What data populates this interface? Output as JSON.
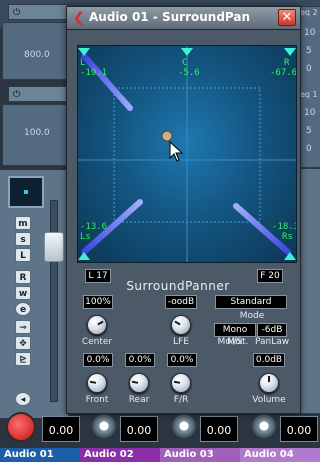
{
  "mixer": {
    "top_num_1": "800.0",
    "top_num_2": "100.0",
    "right_label_1": "eq 2",
    "right_label_2": "eq 1",
    "right_nums": [
      "10",
      "5",
      "0",
      "10",
      "5",
      "0",
      "5",
      "7.0"
    ],
    "side_buttons": [
      "m",
      "s",
      "L",
      "R",
      "w",
      "e"
    ],
    "channels": [
      {
        "name": "Audio 01",
        "value": "0.00",
        "unit": "-∞"
      },
      {
        "name": "Audio 02",
        "value": "0.00",
        "unit": "-∞"
      },
      {
        "name": "Audio 03",
        "value": "0.00",
        "unit": "-∞"
      },
      {
        "name": "Audio 04",
        "value": "0.00",
        "unit": "-∞"
      }
    ]
  },
  "window": {
    "title": "Audio 01 - SurroundPan",
    "close_label": "✕"
  },
  "speakers": {
    "L": {
      "label": "L",
      "value": "-19.1"
    },
    "C": {
      "label": "C",
      "value": "-5.6"
    },
    "R": {
      "label": "R",
      "value": "-67.6"
    },
    "Ls": {
      "label": "Ls",
      "value": "-13.6"
    },
    "Rs": {
      "label": "Rs",
      "value": "-18.3"
    }
  },
  "panner": {
    "plugin_name": "SurroundPanner",
    "left_field": "L 17",
    "right_field": "F 20",
    "center_value": "100%",
    "center_label": "Center",
    "lfe_value": "-oodB",
    "lfe_label": "LFE",
    "mode_value": "Standard",
    "mode_label": "Mode",
    "mono_mix": "Mono Mix",
    "pan_law_value": "-6dB",
    "mono_st_label": "Mo./St.",
    "pan_law_label": "PanLaw",
    "front_value": "0.0%",
    "front_label": "Front",
    "rear_value": "0.0%",
    "rear_label": "Rear",
    "fr_value": "0.0%",
    "fr_label": "F/R",
    "volume_value": "0.0dB",
    "volume_label": "Volume"
  },
  "colors": {
    "accent_green": "#31f25a",
    "beam_blue": "#5a70ff",
    "record_red": "#e02020"
  }
}
